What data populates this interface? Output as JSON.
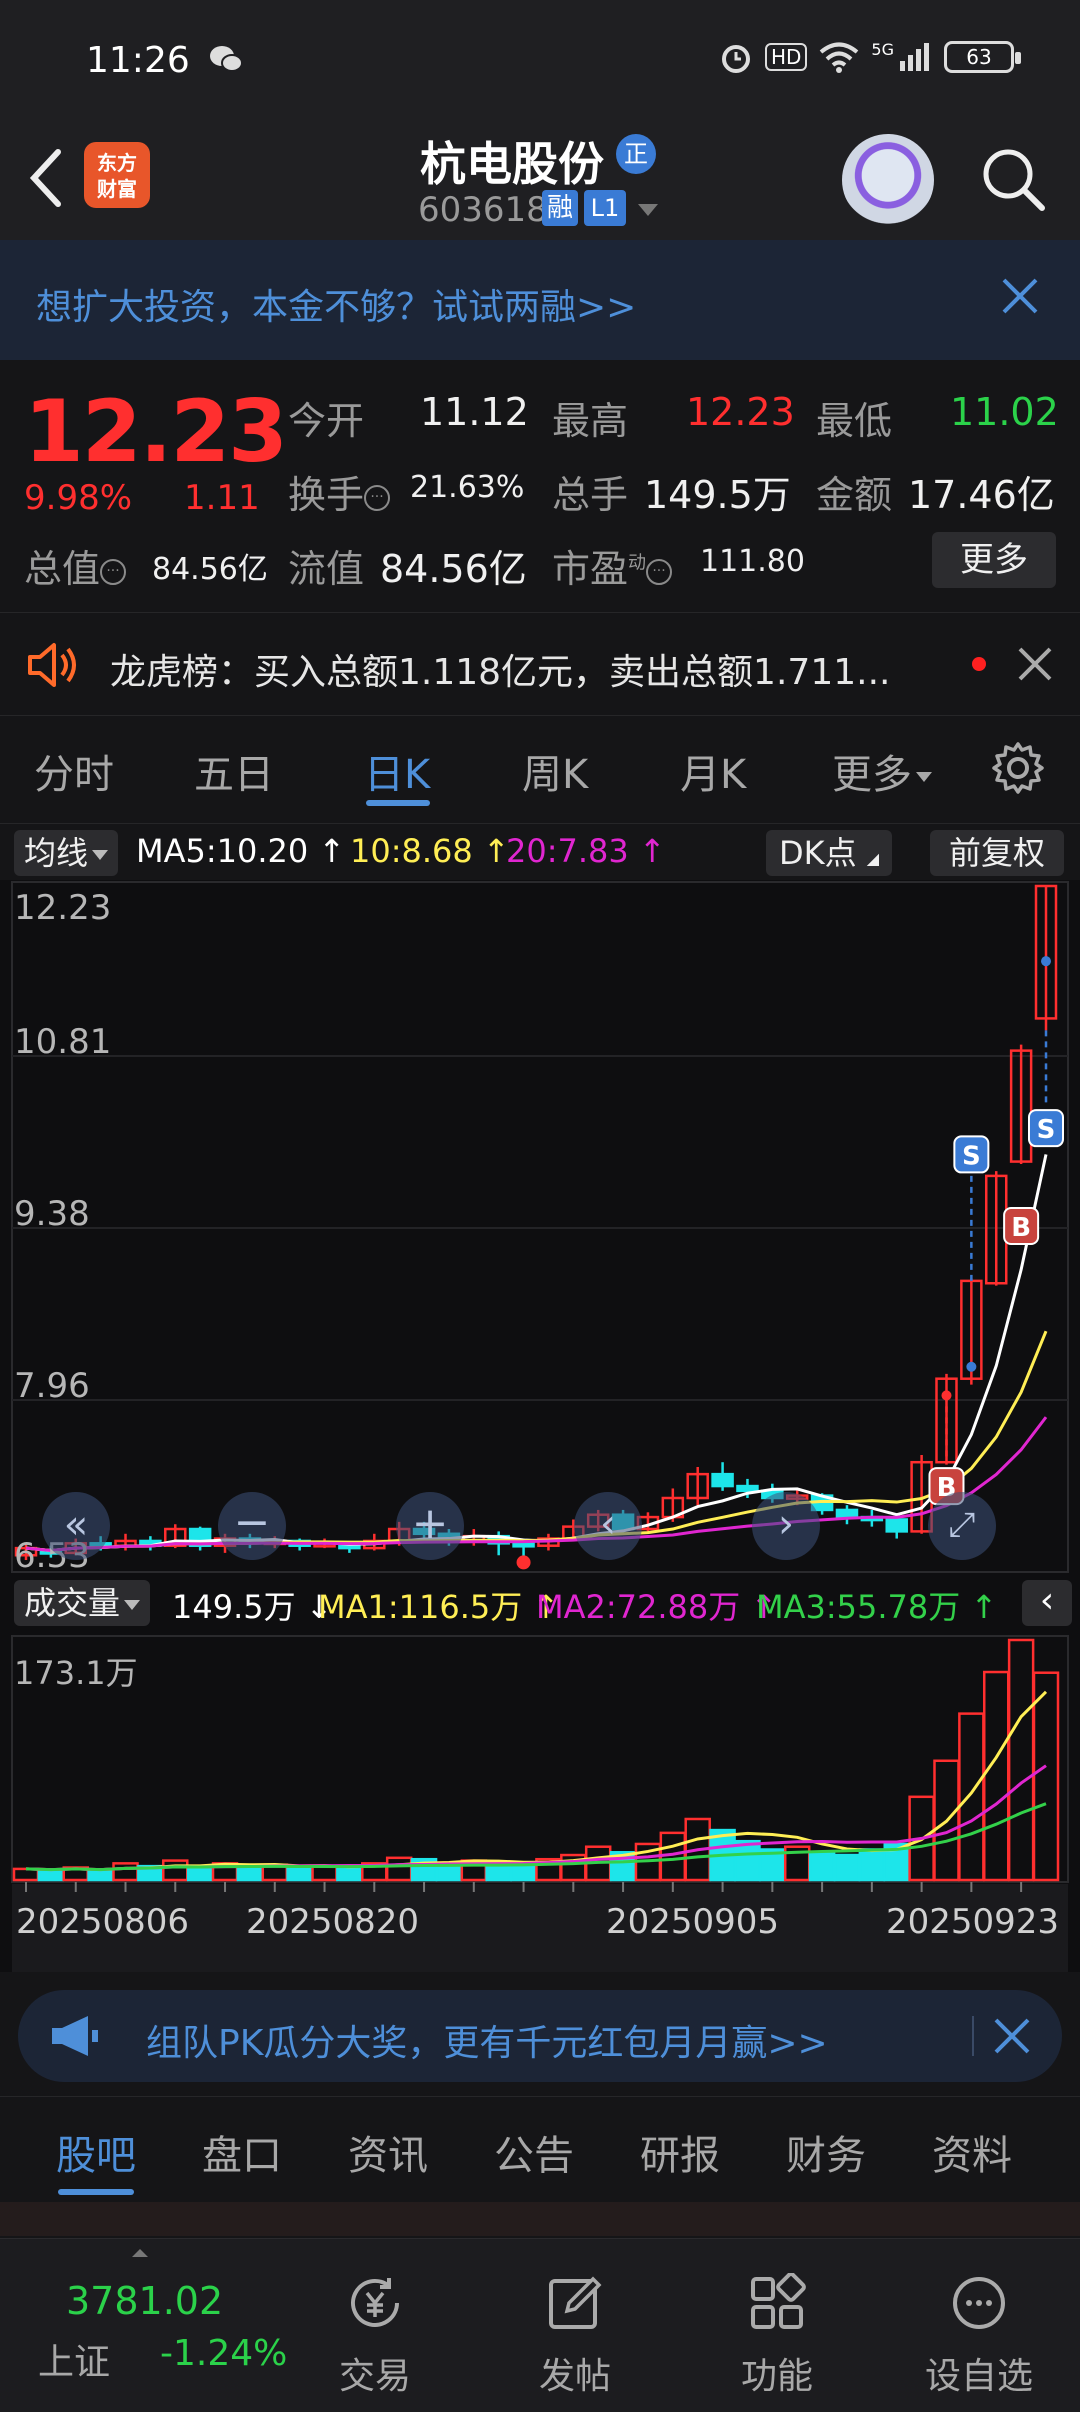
{
  "status_bar": {
    "time": "11:26",
    "network": "5G",
    "hd": "HD",
    "battery": "63"
  },
  "header": {
    "logo_text": "东方\n财富",
    "logo_line1": "东方",
    "logo_line2": "财富",
    "stock_name": "杭电股份",
    "badge": "正",
    "stock_code": "603618",
    "tag_margin": "融",
    "tag_level": "L1"
  },
  "promo_top": {
    "text": "想扩大投资，本金不够？试试两融>>"
  },
  "quote": {
    "price": "12.23",
    "change_pct": "9.98%",
    "change": "1.11",
    "fields": {
      "open_label": "今开",
      "open": "11.12",
      "high_label": "最高",
      "high": "12.23",
      "low_label": "最低",
      "low": "11.02",
      "turnover_label": "换手",
      "turnover": "21.63%",
      "volume_label": "总手",
      "volume": "149.5万",
      "amount_label": "金额",
      "amount": "17.46亿",
      "mktcap_label": "总值",
      "mktcap": "84.56亿",
      "float_label": "流值",
      "float": "84.56亿",
      "pe_label": "市盈",
      "pe_sup": "动",
      "pe": "111.80"
    },
    "more_label": "更多"
  },
  "dragon_tiger": {
    "text": "龙虎榜：买入总额1.118亿元，卖出总额1.711..."
  },
  "chart_tabs": [
    "分时",
    "五日",
    "日K",
    "周K",
    "月K",
    "更多"
  ],
  "active_chart_tab": "日K",
  "ma_bar": {
    "button": "均线",
    "ma5": "MA5:10.20",
    "ma10": "10:8.68",
    "ma20": "20:7.83",
    "dk_button": "DK点",
    "adjust_button": "前复权"
  },
  "price_axis": [
    "12.23",
    "10.81",
    "9.38",
    "7.96",
    "6.53"
  ],
  "volume_bar": {
    "button": "成交量",
    "vol": "149.5万",
    "ma1": "MA1:116.5万",
    "ma2": "MA2:72.88万",
    "ma3": "MA3:55.78万",
    "axis_max": "173.1万"
  },
  "signals": {
    "buy": "B",
    "sell": "S"
  },
  "dates": [
    "20250806",
    "20250820",
    "20250905",
    "20250923"
  ],
  "colors": {
    "up": "#ff2f2f",
    "down": "#1de5ea",
    "ma5": "#ffffff",
    "ma10": "#ffee55",
    "ma20": "#e026d0",
    "ma3": "#33d14a",
    "accent": "#4e8fd9"
  },
  "promo_bottom": {
    "text": "组队PK瓜分大奖，更有千元红包月月赢>>"
  },
  "bottom_tabs": [
    "股吧",
    "盘口",
    "资讯",
    "公告",
    "研报",
    "财务",
    "资料"
  ],
  "bottom_bar": {
    "index_value": "3781.02",
    "index_name": "上证",
    "index_pct": "-1.24%",
    "items": [
      "交易",
      "发帖",
      "功能",
      "设自选"
    ]
  }
}
